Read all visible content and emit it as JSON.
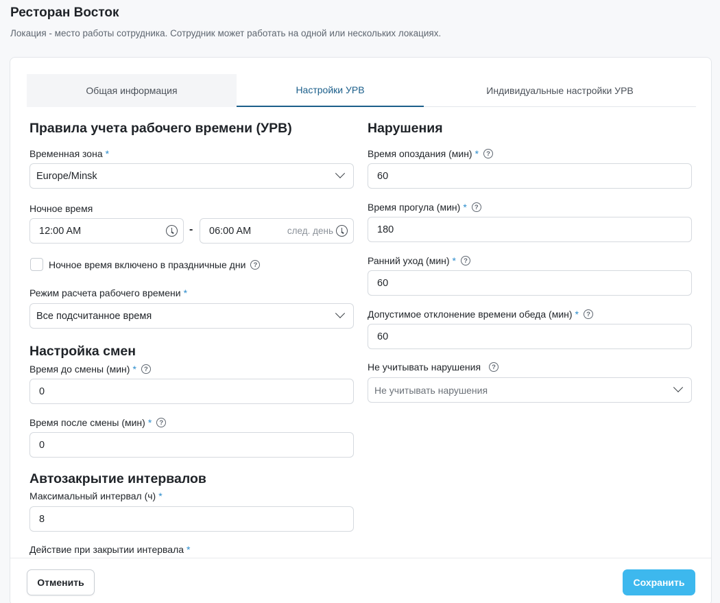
{
  "page": {
    "title": "Ресторан Восток",
    "subtitle": "Локация - место работы сотрудника. Сотрудник может работать на одной или нескольких локациях."
  },
  "tabs": [
    {
      "label": "Общая информация"
    },
    {
      "label": "Настройки УРВ"
    },
    {
      "label": "Индивидуальные настройки УРВ"
    }
  ],
  "left": {
    "rules_title": "Правила учета рабочего времени (УРВ)",
    "timezone": {
      "label": "Временная зона",
      "value": "Europe/Minsk"
    },
    "night": {
      "label": "Ночное время",
      "from": "12:00 AM",
      "to": "06:00 AM",
      "dash": "-",
      "next_day": "след. день"
    },
    "holiday_checkbox": {
      "label": "Ночное время включено в праздничные дни"
    },
    "calc_mode": {
      "label": "Режим расчета рабочего времени",
      "value": "Все подсчитанное время"
    },
    "shifts_title": "Настройка смен",
    "before_shift": {
      "label": "Время до смены (мин)",
      "value": "0"
    },
    "after_shift": {
      "label": "Время после смены (мин)",
      "value": "0"
    },
    "autoclose_title": "Автозакрытие интервалов",
    "max_interval": {
      "label": "Максимальный интервал (ч)",
      "value": "8"
    },
    "close_action": {
      "label": "Действие при закрытии интервала"
    }
  },
  "right": {
    "violations_title": "Нарушения",
    "late": {
      "label": "Время опоздания (мин)",
      "value": "60"
    },
    "absence": {
      "label": "Время прогула (мин)",
      "value": "180"
    },
    "early_leave": {
      "label": "Ранний уход (мин)",
      "value": "60"
    },
    "lunch_dev": {
      "label": "Допустимое отклонение времени обеда (мин)",
      "value": "60"
    },
    "ignore": {
      "label": "Не учитывать нарушения",
      "placeholder": "Не учитывать нарушения"
    }
  },
  "footer": {
    "cancel": "Отменить",
    "save": "Сохранить"
  },
  "required_mark": "*",
  "help_glyph": "?"
}
